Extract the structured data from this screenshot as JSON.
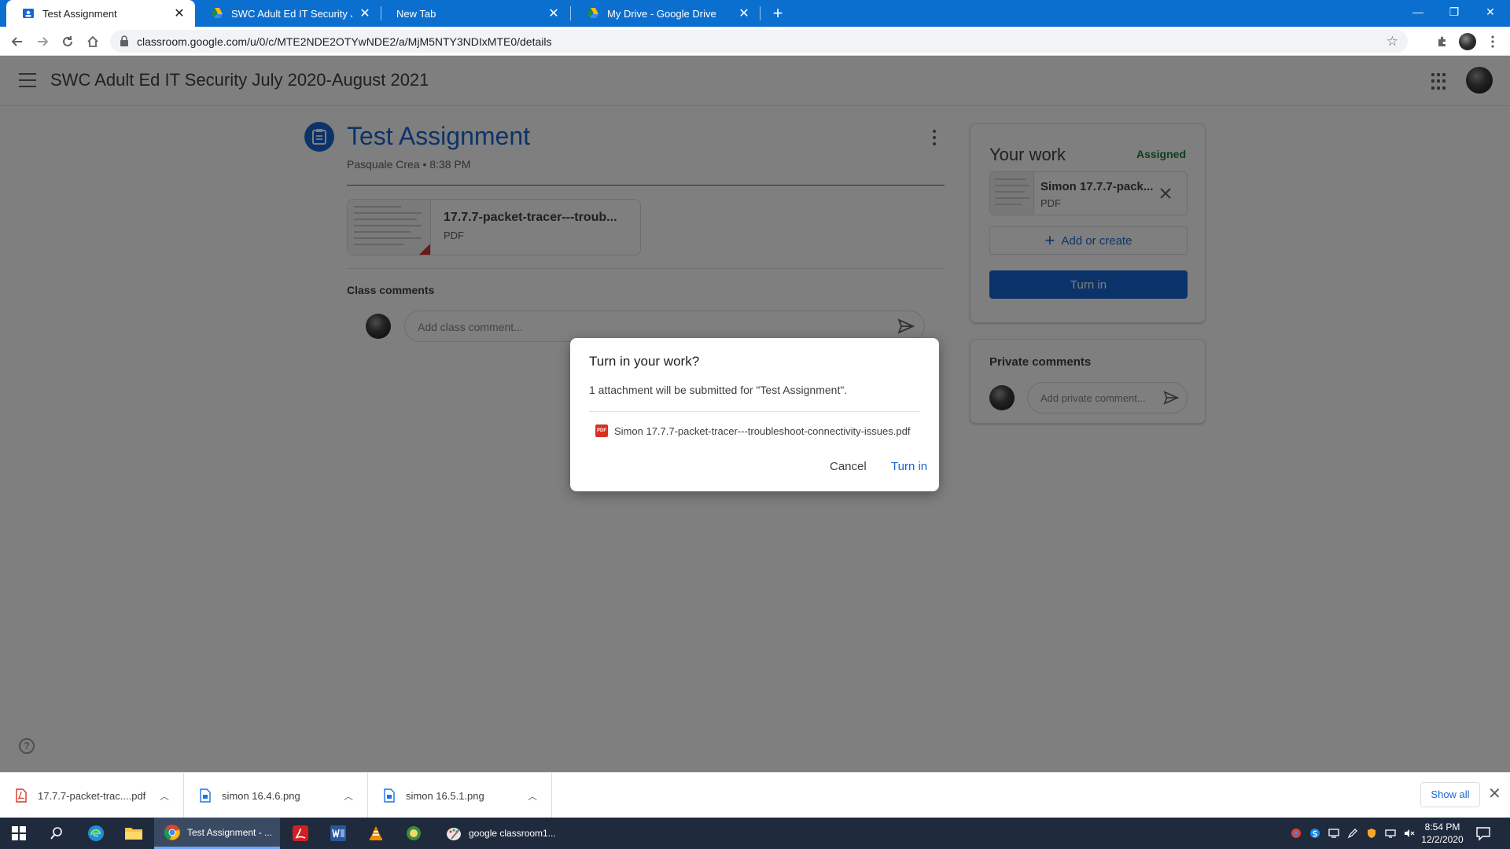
{
  "browser": {
    "tabs": [
      {
        "title": "Test Assignment",
        "active": true
      },
      {
        "title": "SWC Adult Ed IT Security July 2020-August 2021",
        "active": false
      },
      {
        "title": "New Tab",
        "active": false
      },
      {
        "title": "My Drive - Google Drive",
        "active": false
      }
    ],
    "url": "classroom.google.com/u/0/c/MTE2NDE2OTYwNDE2/a/MjM5NTY3NDIxMTE0/details",
    "tab_color": "#0b6fd0"
  },
  "classroom": {
    "class_title": "SWC Adult Ed IT Security July 2020-August 2021",
    "assignment": {
      "title": "Test Assignment",
      "meta": "Pasquale Crea • 8:38 PM",
      "attachment": {
        "name": "17.7.7-packet-tracer---troub...",
        "type": "PDF"
      }
    },
    "class_comments": {
      "heading": "Class comments",
      "placeholder": "Add class comment..."
    },
    "your_work": {
      "title": "Your work",
      "status": "Assigned",
      "file": {
        "name": "Simon 17.7.7-pack...",
        "type": "PDF"
      },
      "add_label": "Add or create",
      "turn_in_label": "Turn in"
    },
    "private_comments": {
      "title": "Private comments",
      "placeholder": "Add private comment..."
    },
    "accent_color": "#1967d2",
    "status_color": "#188038"
  },
  "dialog": {
    "title": "Turn in your work?",
    "body": "1 attachment will be submitted for \"Test Assignment\".",
    "file_icon_text": "PDF",
    "file_name": "Simon 17.7.7-packet-tracer---troubleshoot-connectivity-issues.pdf",
    "cancel_label": "Cancel",
    "confirm_label": "Turn in"
  },
  "downloads": {
    "items": [
      {
        "name": "17.7.7-packet-trac....pdf",
        "icon": "pdf-icon"
      },
      {
        "name": "simon 16.4.6.png",
        "icon": "image-file-icon"
      },
      {
        "name": "simon 16.5.1.png",
        "icon": "image-file-icon"
      }
    ],
    "show_all_label": "Show all"
  },
  "taskbar": {
    "apps": [
      {
        "label": "Test Assignment - ...",
        "icon": "chrome-icon",
        "active": true
      },
      {
        "label": "google classroom1...",
        "icon": "paint-icon",
        "active": false
      }
    ],
    "time": "8:54 PM",
    "date": "12/2/2020"
  }
}
